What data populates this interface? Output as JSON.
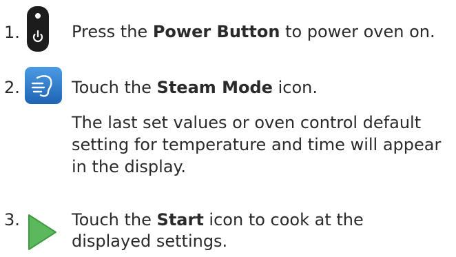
{
  "steps": [
    {
      "number": "1.",
      "icon": "power-button-icon",
      "text_pre": "Press the ",
      "text_bold": "Power Button",
      "text_post": " to power oven on."
    },
    {
      "number": "2.",
      "icon": "steam-mode-icon",
      "text_pre": "Touch the ",
      "text_bold": "Steam Mode",
      "text_post": " icon.",
      "note": "The last set values or oven control default setting for temperature and time will appear in the display."
    },
    {
      "number": "3.",
      "icon": "start-play-icon",
      "text_pre": "Touch the ",
      "text_bold": "Start",
      "text_post": " icon to cook at the",
      "text_line2": "displayed settings."
    }
  ],
  "colors": {
    "text": "#2a2a2a",
    "power_icon_body": "#1c1c1c",
    "steam_icon_blue": "#2f7fd0",
    "start_icon_green": "#5cb85c"
  }
}
